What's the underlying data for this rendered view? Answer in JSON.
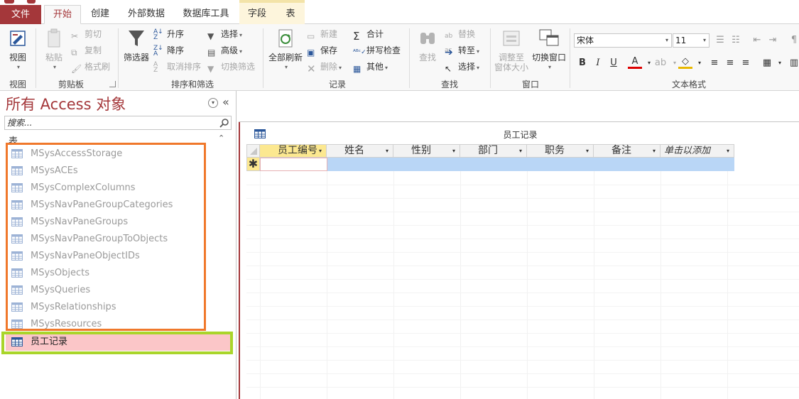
{
  "ribbon_tabs": {
    "file": "文件",
    "home": "开始",
    "create": "创建",
    "external_data": "外部数据",
    "database_tools": "数据库工具",
    "fields": "字段",
    "table": "表"
  },
  "groups": {
    "views": "视图",
    "clipboard": "剪贴板",
    "sort_filter": "排序和筛选",
    "records": "记录",
    "find": "查找",
    "window": "窗口",
    "text_format": "文本格式"
  },
  "buttons": {
    "view": "视图",
    "paste": "粘贴",
    "cut": "剪切",
    "copy": "复制",
    "format_painter": "格式刷",
    "filter": "筛选器",
    "ascending": "升序",
    "descending": "降序",
    "remove_sort": "取消排序",
    "selection": "选择",
    "advanced": "高级",
    "toggle_filter": "切换筛选",
    "refresh_all": "全部刷新",
    "new": "新建",
    "save": "保存",
    "delete": "删除",
    "totals": "合计",
    "spelling": "拼写检查",
    "more": "其他",
    "find": "查找",
    "replace": "替换",
    "goto": "转至",
    "select": "选择",
    "size_to_fit_1": "调整至",
    "size_to_fit_2": "窗体大小",
    "switch_windows": "切换窗口",
    "bold": "B",
    "italic": "I",
    "underline": "U",
    "font_color": "A"
  },
  "format": {
    "font_name": "宋体",
    "font_size": "11"
  },
  "nav": {
    "title": "所有 Access 对象",
    "search_placeholder": "搜索...",
    "group": "表",
    "items": [
      "MSysAccessStorage",
      "MSysACEs",
      "MSysComplexColumns",
      "MSysNavPaneGroupCategories",
      "MSysNavPaneGroups",
      "MSysNavPaneGroupToObjects",
      "MSysNavPaneObjectIDs",
      "MSysObjects",
      "MSysQueries",
      "MSysRelationships",
      "MSysResources"
    ],
    "selected_item": "员工记录"
  },
  "document": {
    "title": "员工记录",
    "columns": [
      "员工编号",
      "姓名",
      "性别",
      "部门",
      "职务",
      "备注",
      "单击以添加"
    ],
    "new_row_marker": "✱"
  },
  "colors": {
    "accent": "#a4373a",
    "selection_highlight": "#fbc6c8",
    "orange_annotation": "#f0782b",
    "green_annotation": "#a9d52a",
    "new_row": "#b9d6f6",
    "header_active": "#fce890"
  }
}
